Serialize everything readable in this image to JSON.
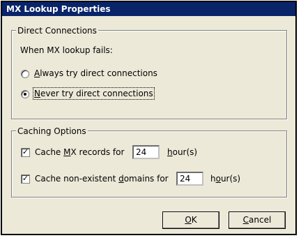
{
  "window": {
    "title": "MX Lookup Properties"
  },
  "direct": {
    "group_label": "Direct Connections",
    "prompt": "When MX lookup fails:",
    "option_always": "Always try direct connections",
    "option_never": "Never try direct connections",
    "selected": "never"
  },
  "caching": {
    "group_label": "Caching Options",
    "mx_label": "Cache MX records for",
    "mx_value": "24",
    "mx_unit": "hour(s)",
    "mx_checked": true,
    "nx_label": "Cache non-existent domains for",
    "nx_value": "24",
    "nx_unit": "hour(s)",
    "nx_checked": true
  },
  "buttons": {
    "ok": "OK",
    "cancel": "Cancel"
  }
}
